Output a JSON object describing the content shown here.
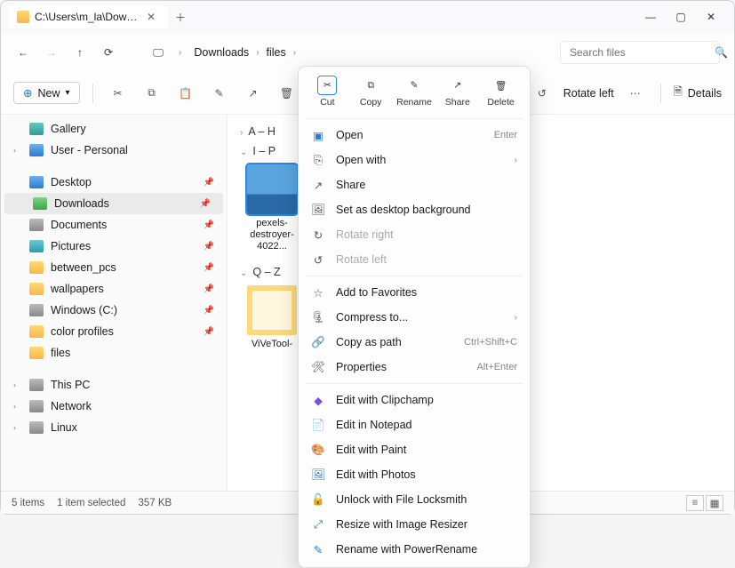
{
  "titlebar": {
    "path": "C:\\Users\\m_la\\Downloads\\file"
  },
  "nav": {
    "crumbs": [
      "Downloads",
      "files"
    ],
    "search_placeholder": "Search files"
  },
  "toolbar": {
    "new": "New",
    "rotate_left": "Rotate left",
    "details": "Details"
  },
  "sidebar": {
    "gallery": "Gallery",
    "user": "User - Personal",
    "desktop": "Desktop",
    "downloads": "Downloads",
    "documents": "Documents",
    "pictures": "Pictures",
    "between": "between_pcs",
    "wallpapers": "wallpapers",
    "windows_c": "Windows (C:)",
    "color_profiles": "color profiles",
    "files": "files",
    "this_pc": "This PC",
    "network": "Network",
    "linux": "Linux"
  },
  "groups": {
    "ah": "A – H",
    "ip": "I – P",
    "qz": "Q – Z"
  },
  "tiles": {
    "photo": "pexels-destroyer-4022...",
    "folder": "ViVeTool-"
  },
  "ctx": {
    "bar": {
      "cut": "Cut",
      "copy": "Copy",
      "rename": "Rename",
      "share": "Share",
      "delete": "Delete"
    },
    "open": "Open",
    "open_hint": "Enter",
    "open_with": "Open with",
    "share2": "Share",
    "set_bg": "Set as desktop background",
    "rot_right": "Rotate right",
    "rot_left": "Rotate left",
    "add_fav": "Add to Favorites",
    "compress": "Compress to...",
    "copy_path": "Copy as path",
    "copy_path_hint": "Ctrl+Shift+C",
    "properties": "Properties",
    "properties_hint": "Alt+Enter",
    "edit_clipchamp": "Edit with Clipchamp",
    "edit_notepad": "Edit in Notepad",
    "edit_paint": "Edit with Paint",
    "edit_photos": "Edit with Photos",
    "unlock": "Unlock with File Locksmith",
    "resize": "Resize with Image Resizer",
    "rename_pr": "Rename with PowerRename"
  },
  "status": {
    "count": "5 items",
    "sel": "1 item selected",
    "size": "357 KB"
  }
}
